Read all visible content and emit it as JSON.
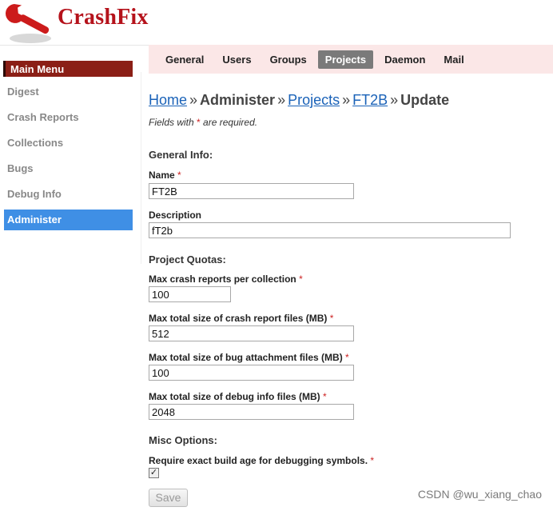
{
  "app": {
    "name": "CrashFix"
  },
  "topnav": {
    "tabs": [
      {
        "label": "General",
        "active": false
      },
      {
        "label": "Users",
        "active": false
      },
      {
        "label": "Groups",
        "active": false
      },
      {
        "label": "Projects",
        "active": true
      },
      {
        "label": "Daemon",
        "active": false
      },
      {
        "label": "Mail",
        "active": false
      }
    ]
  },
  "sidebar": {
    "header": "Main Menu",
    "items": [
      {
        "label": "Digest",
        "active": false
      },
      {
        "label": "Crash Reports",
        "active": false
      },
      {
        "label": "Collections",
        "active": false
      },
      {
        "label": "Bugs",
        "active": false
      },
      {
        "label": "Debug Info",
        "active": false
      },
      {
        "label": "Administer",
        "active": true
      }
    ]
  },
  "breadcrumb": {
    "home": "Home",
    "administer": "Administer",
    "projects": "Projects",
    "project": "FT2B",
    "current": "Update",
    "separator": "»"
  },
  "form": {
    "required_note_prefix": "Fields with",
    "required_mark": "*",
    "required_note_suffix": "are required.",
    "general_section": "General Info:",
    "name_label": "Name",
    "name_value": "FT2B",
    "description_label": "Description",
    "description_value": "fT2b",
    "quotas_section": "Project Quotas:",
    "max_reports_label": "Max crash reports per collection",
    "max_reports_value": "100",
    "max_report_size_label": "Max total size of crash report files (MB)",
    "max_report_size_value": "512",
    "max_bug_size_label": "Max total size of bug attachment files (MB)",
    "max_bug_size_value": "100",
    "max_debug_size_label": "Max total size of debug info files (MB)",
    "max_debug_size_value": "2048",
    "misc_section": "Misc Options:",
    "exact_build_label": "Require exact build age for debugging symbols.",
    "exact_build_checked": true,
    "checkbox_glyph": "✓",
    "save_label": "Save"
  },
  "watermark": "CSDN @wu_xiang_chao",
  "colors": {
    "brand": "#b5121b",
    "active_tab": "#7a7a7a",
    "topnav_bg": "#fbe7e7",
    "menu_header": "#8b1f16",
    "active_sidebar": "#3f8fe5",
    "link": "#1a62b8",
    "required": "#cc2222"
  }
}
